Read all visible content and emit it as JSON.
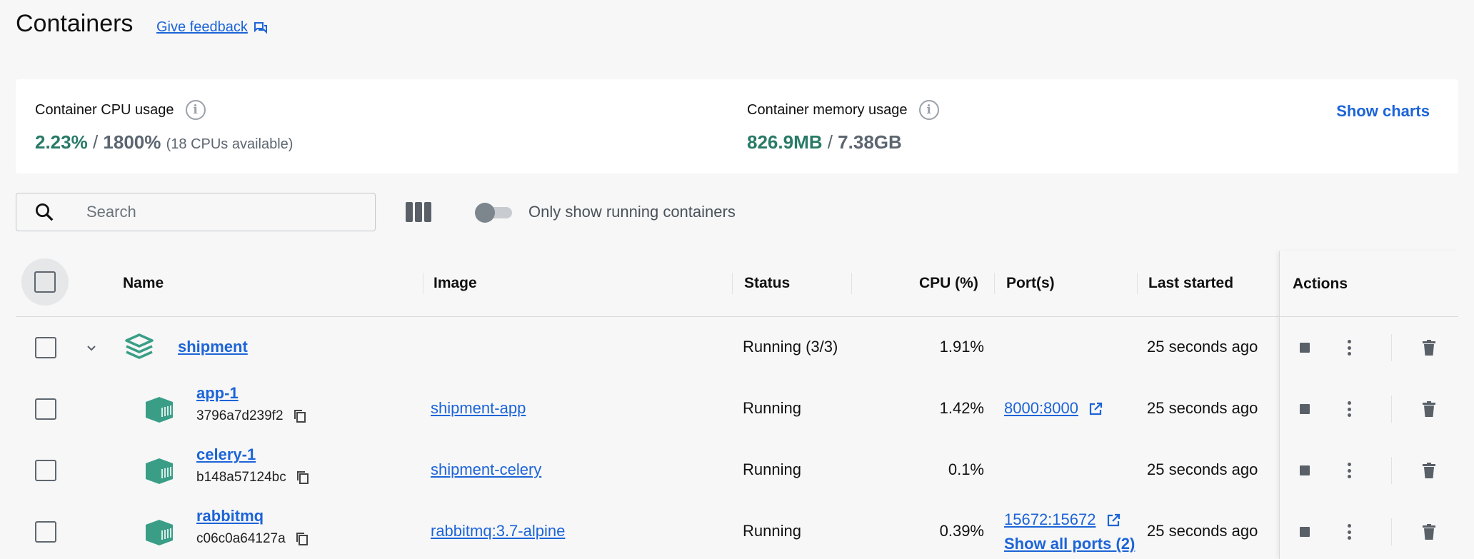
{
  "header": {
    "title": "Containers",
    "feedback_label": "Give feedback",
    "feedback_icon": "feedback-chat-icon"
  },
  "stats": {
    "cpu_label": "Container CPU usage",
    "cpu_used": "2.23%",
    "cpu_sep": " / ",
    "cpu_total": "1800%",
    "cpu_note": "(18 CPUs available)",
    "mem_label": "Container memory usage",
    "mem_used": "826.9MB",
    "mem_sep": " / ",
    "mem_total": "7.38GB",
    "show_charts": "Show charts",
    "accent_color": "#2a7a68"
  },
  "toolbar": {
    "search_placeholder": "Search",
    "toggle_label": "Only show running containers",
    "toggle_on": false
  },
  "table": {
    "columns": {
      "name": "Name",
      "image": "Image",
      "status": "Status",
      "cpu": "CPU (%)",
      "ports": "Port(s)",
      "last_started": "Last started",
      "actions": "Actions"
    },
    "rows": [
      {
        "name": "shipment",
        "id": "",
        "image": "",
        "status": "Running (3/3)",
        "cpu": "1.91%",
        "port": "",
        "show_ports": "",
        "last_started": "25 seconds ago",
        "kind": "compose-stack"
      },
      {
        "name": "app-1",
        "id": "3796a7d239f2",
        "image": "shipment-app",
        "status": "Running",
        "cpu": "1.42%",
        "port": "8000:8000",
        "show_ports": "",
        "last_started": "25 seconds ago",
        "kind": "container"
      },
      {
        "name": "celery-1",
        "id": "b148a57124bc",
        "image": "shipment-celery",
        "status": "Running",
        "cpu": "0.1%",
        "port": "",
        "show_ports": "",
        "last_started": "25 seconds ago",
        "kind": "container"
      },
      {
        "name": "rabbitmq",
        "id": "c06c0a64127a",
        "image": "rabbitmq:3.7-alpine",
        "status": "Running",
        "cpu": "0.39%",
        "port": "15672:15672",
        "show_ports": "Show all ports (2)",
        "last_started": "25 seconds ago",
        "kind": "container"
      }
    ]
  },
  "colors": {
    "link": "#1c64d8",
    "container_icon": "#3a9e87",
    "stack_icon": "#3a9e87"
  }
}
